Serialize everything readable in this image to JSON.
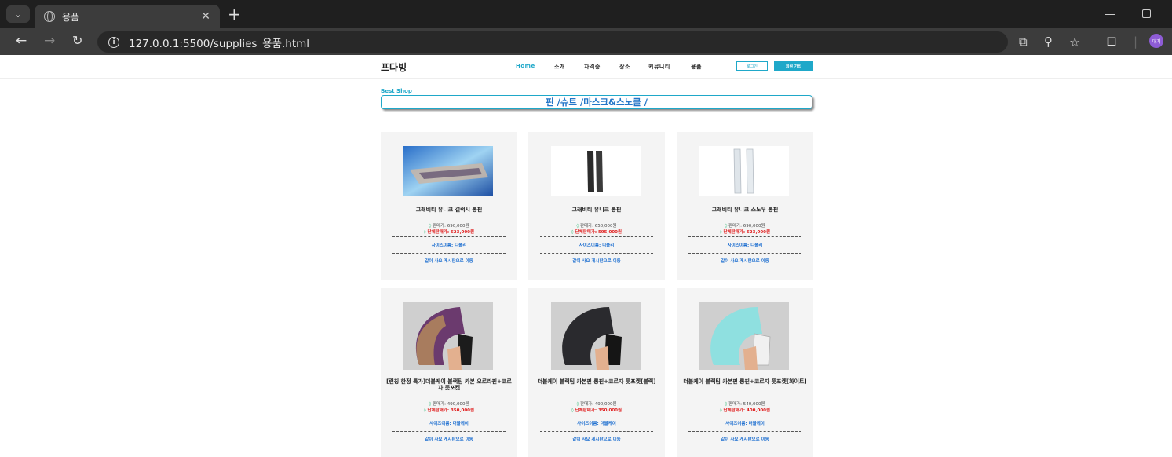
{
  "browser": {
    "tab_title": "용품",
    "url": "127.0.0.1:5500/supplies_용품.html",
    "profile_label": "대기"
  },
  "header": {
    "logo": "프다빙",
    "menu": [
      "Home",
      "소개",
      "자격증",
      "장소",
      "커뮤니티",
      "용품"
    ],
    "login": "로그인",
    "join": "회원 가입"
  },
  "section": {
    "label": "Best Shop",
    "categories": "핀 /슈트 /마스크&스노클 /"
  },
  "products": [
    {
      "name": "그래비티 유니크 갤럭시 롱핀",
      "price": "판매가: 690,000원",
      "group_price": "단체판매가: 623,000원",
      "size": "사이즈이름: 디폴리",
      "used": "같이 사요 게시판으로 이동"
    },
    {
      "name": "그래비티 유니크 롱핀",
      "price": "판매가: 650,000원",
      "group_price": "단체판매가: 595,000원",
      "size": "사이즈이름: 디폴리",
      "used": "같이 사요 게시판으로 이동"
    },
    {
      "name": "그래비티 유니크 스노우 롱핀",
      "price": "판매가: 690,000원",
      "group_price": "단체판매가: 623,000원",
      "size": "사이즈이름: 디폴리",
      "used": "같이 사요 게시판으로 이동"
    },
    {
      "name": "[런칭 한정 특가]더블케이 블랙팀 카본 오로라핀+코르자 풋포켓",
      "price": "판매가: 490,000원",
      "group_price": "단체판매가: 350,000원",
      "size": "사이즈이름: 더블케이",
      "used": "같이 사요 게시판으로 이동"
    },
    {
      "name": "더블케이 블랙팀 카본핀 롱핀+코르자 풋포켓[블랙]",
      "price": "판매가: 490,000원",
      "group_price": "단체판매가: 350,000원",
      "size": "사이즈이름: 더블케이",
      "used": "같이 사요 게시판으로 이동"
    },
    {
      "name": "더블케이 블랙팀 카본핀 롱핀+코르자 풋포켓[화이트]",
      "price": "판매가: 540,000원",
      "group_price": "단체판매가: 400,000원",
      "size": "사이즈이름: 더블케이",
      "used": "같이 사요 게시판으로 이동"
    }
  ],
  "colors": {
    "accent": "#1fa8c9",
    "link": "#1e6fd0",
    "group_price": "#e02020",
    "card_bg": "#f4f4f4"
  }
}
